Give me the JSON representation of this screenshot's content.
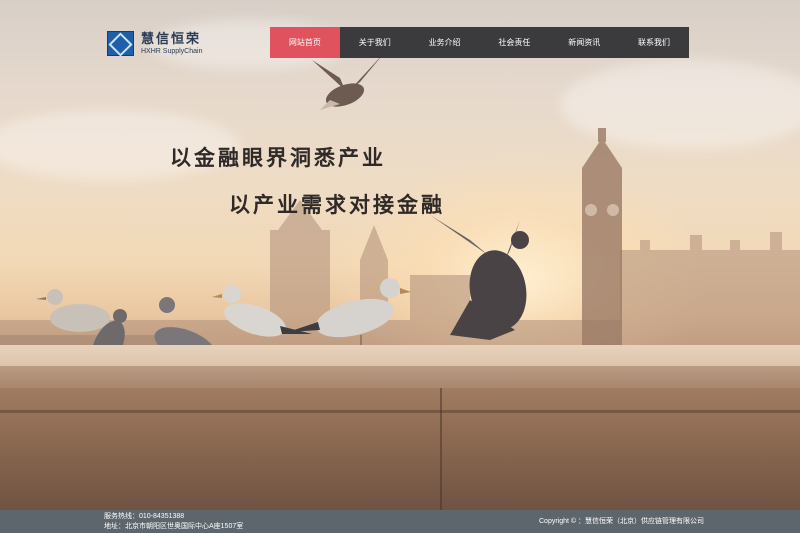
{
  "logo": {
    "name_cn": "慧信恒荣",
    "name_en": "HXHR SupplyChain"
  },
  "nav": {
    "items": [
      {
        "label": "网站首页",
        "active": true
      },
      {
        "label": "关于我们",
        "active": false
      },
      {
        "label": "业务介绍",
        "active": false
      },
      {
        "label": "社会责任",
        "active": false
      },
      {
        "label": "新闻资讯",
        "active": false
      },
      {
        "label": "联系我们",
        "active": false
      }
    ],
    "active_color": "#e0525d",
    "bar_color": "#3b3b3d"
  },
  "hero": {
    "slogan_line1": "以金融眼界洞悉产业",
    "slogan_line2": "以产业需求对接金融"
  },
  "footer": {
    "hotline": "服务热线：010-84351388",
    "address": "地址：北京市朝阳区世奥国际中心A座1507室",
    "copyright": "Copyright © ：慧信恒荣（北京）供应链管理有限公司",
    "background": "#5e666d"
  }
}
